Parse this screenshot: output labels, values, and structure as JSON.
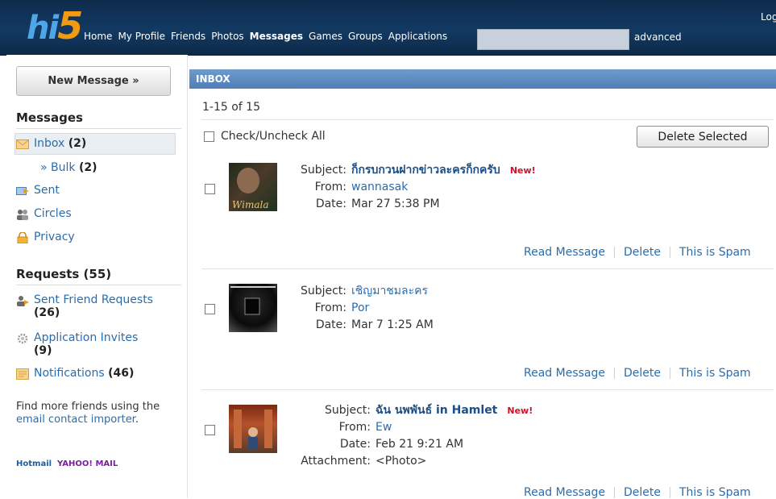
{
  "header": {
    "logo_hi": "hi",
    "logo_five": "5",
    "nav": [
      "Home",
      "My Profile",
      "Friends",
      "Photos",
      "Messages",
      "Games",
      "Groups",
      "Applications"
    ],
    "active_nav": "Messages",
    "advanced_label": "advanced",
    "login_label": "Log"
  },
  "sidebar": {
    "new_message_label": "New Message »",
    "messages_heading": "Messages",
    "items": [
      {
        "label": "Inbox",
        "count": "(2)"
      },
      {
        "label": "» Bulk",
        "count": "(2)"
      },
      {
        "label": "Sent",
        "count": ""
      },
      {
        "label": "Circles",
        "count": ""
      },
      {
        "label": "Privacy",
        "count": ""
      }
    ],
    "requests_heading": "Requests (55)",
    "requests": [
      {
        "label": "Sent Friend Requests",
        "count": "(26)"
      },
      {
        "label": "Application Invites",
        "count": "(9)"
      },
      {
        "label": "Notifications",
        "count": "(46)"
      }
    ],
    "find_text_1": "Find more friends using the ",
    "find_link": "email contact importer",
    "find_text_2": ".",
    "logo_hotmail": "Hotmail",
    "logo_yahoo": "YAHOO! MAIL"
  },
  "inbox": {
    "title": "INBOX",
    "range": "1-15 of 15",
    "check_all_label": "Check/Uncheck All",
    "delete_selected_label": "Delete Selected",
    "labels": {
      "subject": "Subject:",
      "from": "From:",
      "date": "Date:",
      "attachment": "Attachment:"
    },
    "actions": {
      "read": "Read Message",
      "delete": "Delete",
      "spam": "This is Spam"
    },
    "new_badge": "New!",
    "messages": [
      {
        "subject": "ก็กรบกวนฝากข่าวละครก็กครับ",
        "from": "wannasak",
        "date": "Mar 27 5:38 PM",
        "is_new": true,
        "thumb_text": "Wimala"
      },
      {
        "subject": "เชิญมาชมละคร",
        "from": "Por",
        "date": "Mar 7 1:25 AM",
        "is_new": false
      },
      {
        "subject": "ฉัน นพพันธ์ in Hamlet",
        "from": "Ew",
        "date": "Feb 21 9:21 AM",
        "is_new": true,
        "attachment": "<Photo>"
      }
    ]
  }
}
